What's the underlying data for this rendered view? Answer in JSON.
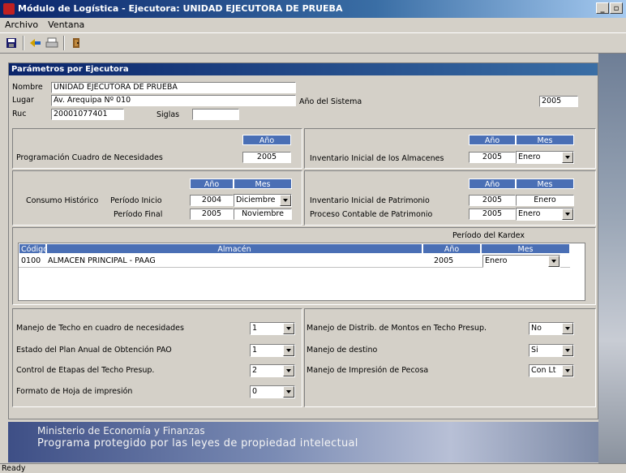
{
  "window": {
    "title": "Módulo de Logística - Ejecutora: UNIDAD EJECUTORA DE PRUEBA",
    "min": "_",
    "max": "▫"
  },
  "menu": {
    "archivo": "Archivo",
    "ventana": "Ventana"
  },
  "form_title": "Parámetros por Ejecutora",
  "header": {
    "nombre_label": "Nombre",
    "nombre_value": "UNIDAD EJECUTORA DE PRUEBA",
    "lugar_label": "Lugar",
    "lugar_value": "Av. Arequipa Nº 010",
    "ruc_label": "Ruc",
    "ruc_value": "20001077401",
    "siglas_label": "Siglas",
    "siglas_value": "",
    "anio_sistema_label": "Año del Sistema",
    "anio_sistema_value": "2005"
  },
  "programacion": {
    "label": "Programación Cuadro de Necesidades",
    "anio_header": "Año",
    "anio_value": "2005"
  },
  "inventario_almacenes": {
    "label": "Inventario Inicial de los Almacenes",
    "anio_header": "Año",
    "mes_header": "Mes",
    "anio_value": "2005",
    "mes_value": "Enero"
  },
  "consumo": {
    "label": "Consumo Histórico",
    "anio_header": "Año",
    "mes_header": "Mes",
    "inicio_label": "Período Inicio",
    "inicio_anio": "2004",
    "inicio_mes": "Diciembre",
    "final_label": "Período Final",
    "final_anio": "2005",
    "final_mes": "Noviembre"
  },
  "patrimonio": {
    "anio_header": "Año",
    "mes_header": "Mes",
    "inv_label": "Inventario Inicial de Patrimonio",
    "inv_anio": "2005",
    "inv_mes": "Enero",
    "proc_label": "Proceso Contable de Patrimonio",
    "proc_anio": "2005",
    "proc_mes": "Enero"
  },
  "kardex": {
    "title": "Período del Kardex",
    "columns": [
      "Código",
      "Almacén",
      "Año",
      "Mes"
    ],
    "rows": [
      {
        "codigo": "0100",
        "almacen": "ALMACEN PRINCIPAL - PAAG",
        "anio": "2005",
        "mes": "Enero"
      }
    ]
  },
  "options_left": [
    {
      "label": "Manejo de Techo en cuadro de necesidades",
      "value": "1"
    },
    {
      "label": "Estado del Plan Anual de Obtención PAO",
      "value": "1"
    },
    {
      "label": "Control de Etapas del Techo Presup.",
      "value": "2"
    },
    {
      "label": "Formato de Hoja de impresión",
      "value": "0"
    }
  ],
  "options_right": [
    {
      "label": "Manejo de Distrib. de Montos en Techo Presup.",
      "value": "No"
    },
    {
      "label": "Manejo de destino",
      "value": "Si"
    },
    {
      "label": "Manejo de Impresión de Pecosa",
      "value": "Con Lt"
    }
  ],
  "banner": {
    "line1": "Ministerio de Economía y Finanzas",
    "line2": "Programa protegido por las leyes de propiedad intelectual"
  },
  "status": "Ready"
}
